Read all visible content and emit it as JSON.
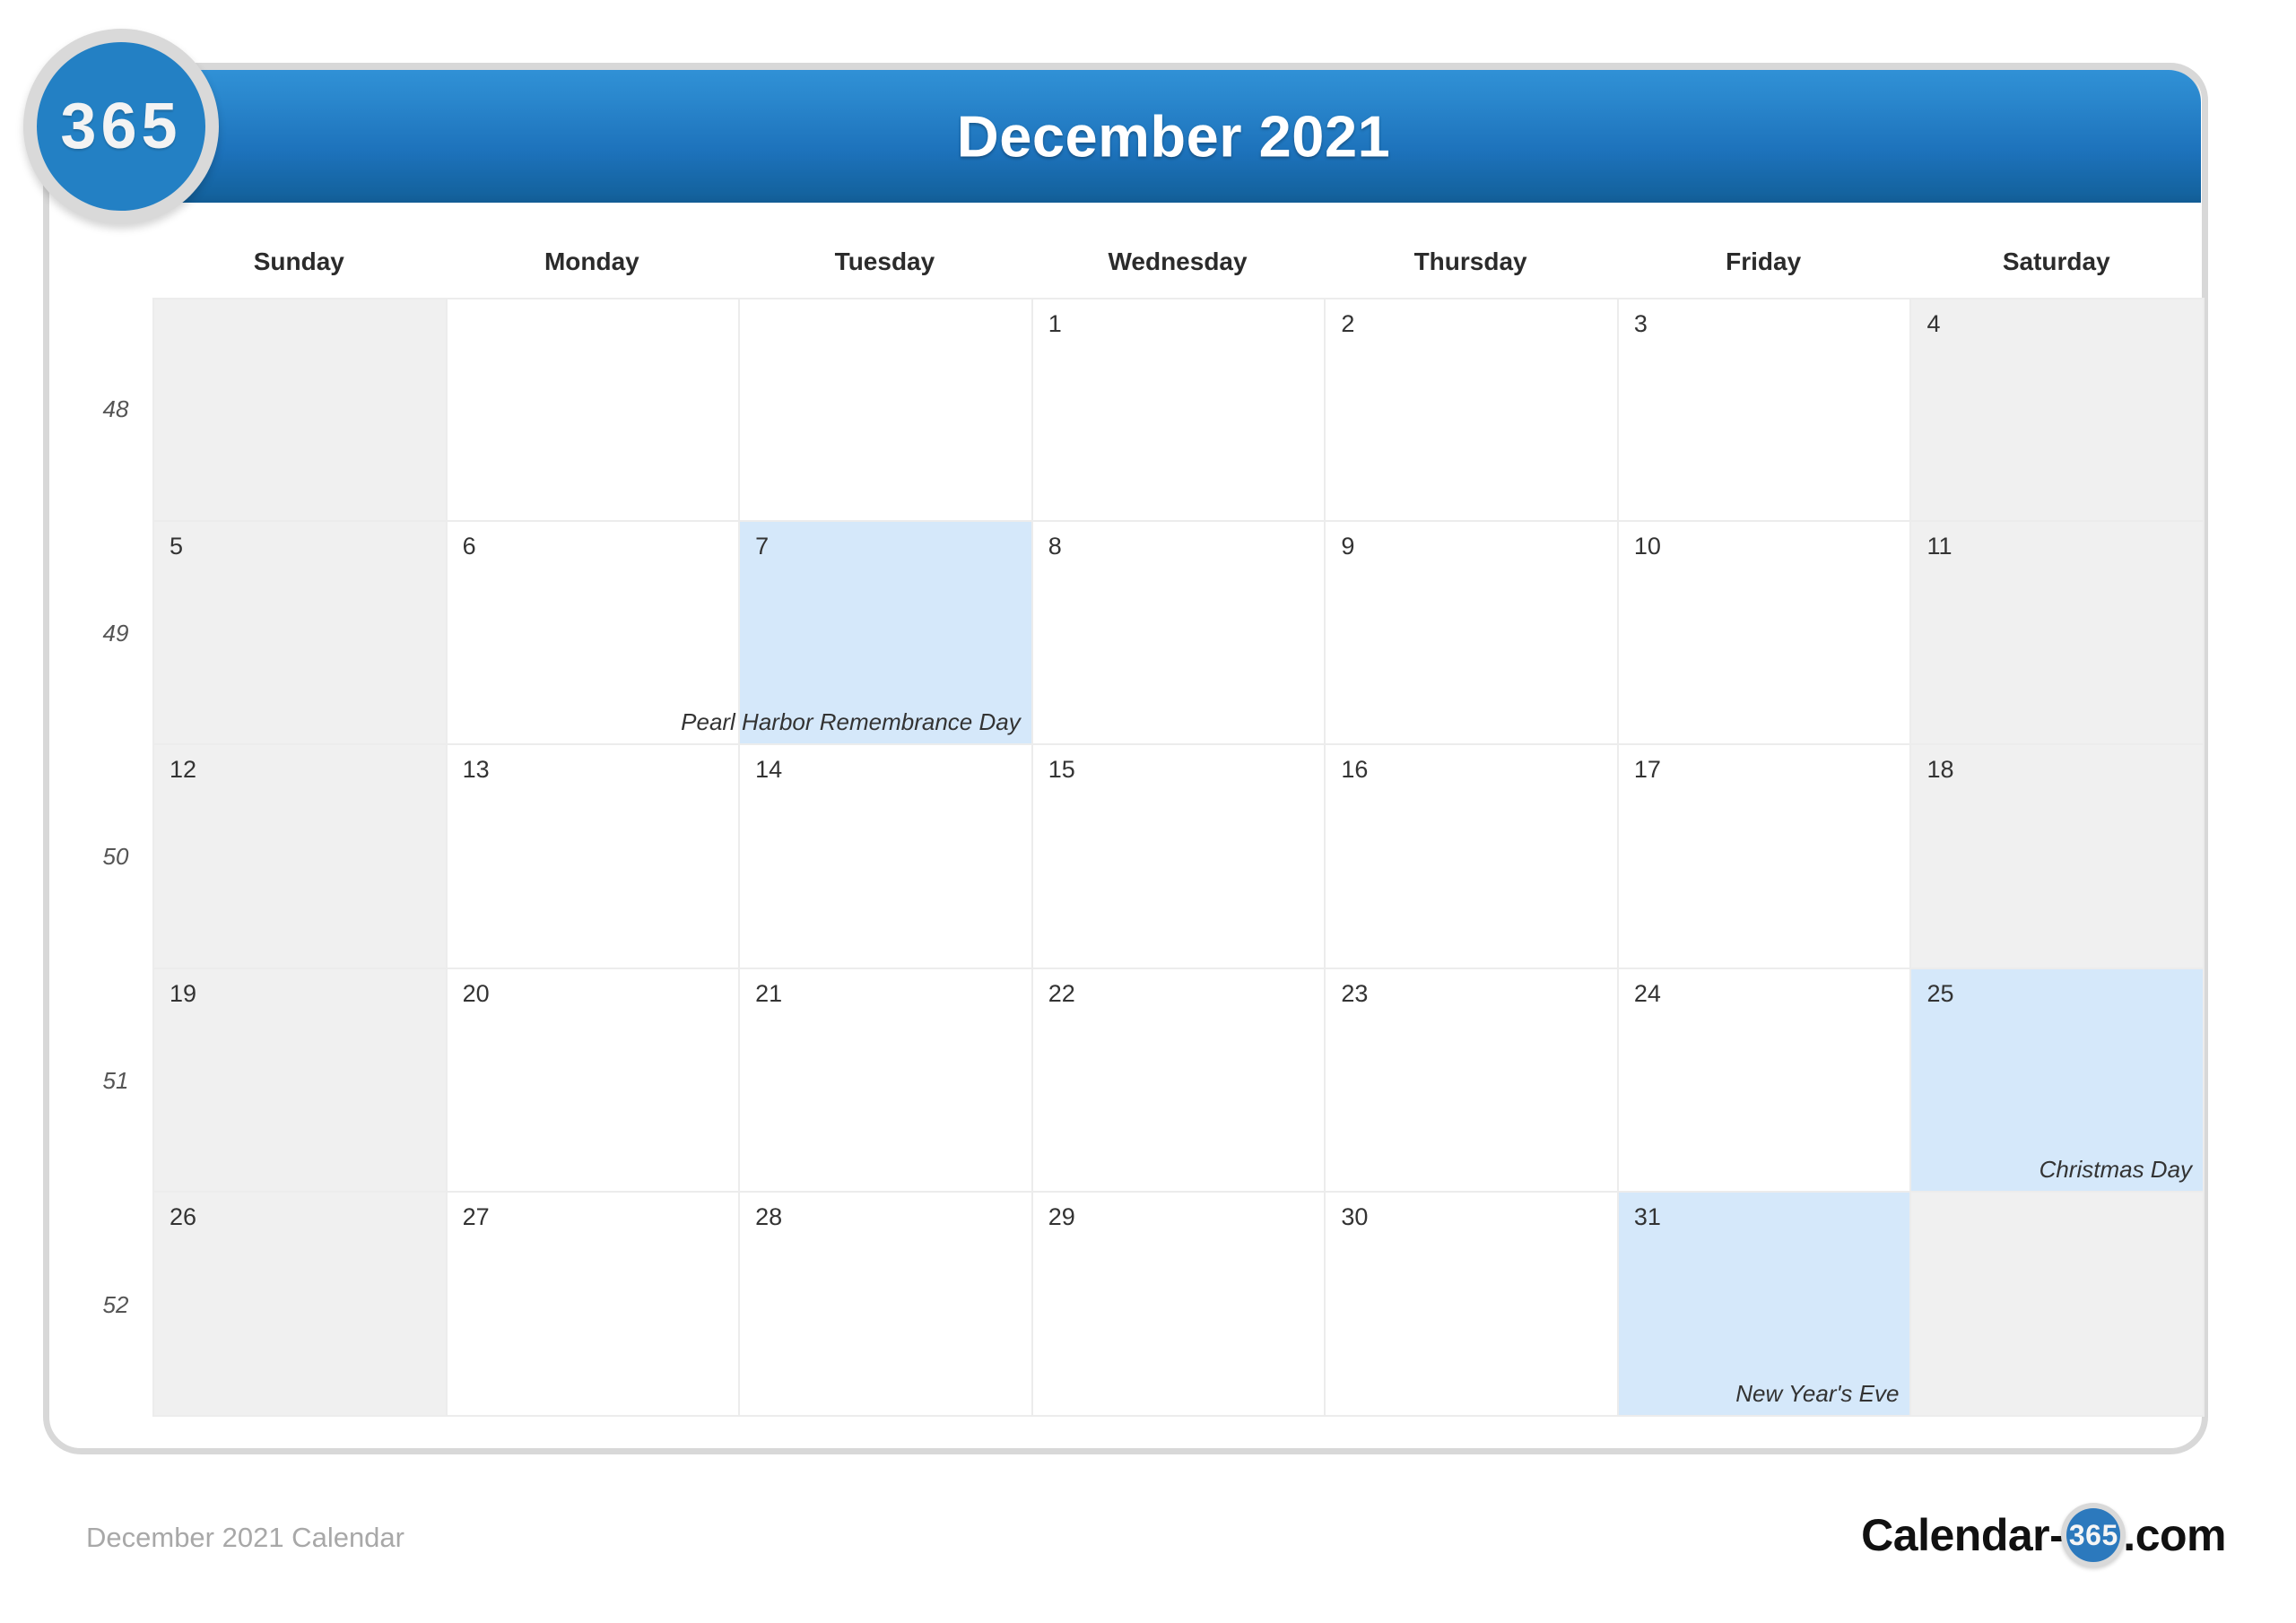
{
  "brand": {
    "badge_text": "365",
    "logo_prefix": "Calendar-",
    "logo_circle": "365",
    "logo_suffix": ".com"
  },
  "header": {
    "title": "December 2021"
  },
  "weekdays": [
    "Sunday",
    "Monday",
    "Tuesday",
    "Wednesday",
    "Thursday",
    "Friday",
    "Saturday"
  ],
  "week_numbers": [
    "48",
    "49",
    "50",
    "51",
    "52"
  ],
  "footer": {
    "caption": "December 2021 Calendar"
  },
  "colors": {
    "header_blue_top": "#3091d6",
    "header_blue_bottom": "#125c95",
    "weekend_shade": "#f0f0f0",
    "holiday_highlight": "#d5e8fa",
    "grid_line": "#ececec",
    "badge_blue": "#2380c4"
  },
  "watermark": "365",
  "calendar": {
    "month": "December",
    "year": "2021",
    "weeks": [
      {
        "week_number": "48",
        "days": [
          {
            "num": "",
            "weekend": true,
            "empty": true,
            "holiday": ""
          },
          {
            "num": "",
            "weekend": false,
            "empty": true,
            "holiday": ""
          },
          {
            "num": "",
            "weekend": false,
            "empty": true,
            "holiday": ""
          },
          {
            "num": "1",
            "weekend": false,
            "empty": false,
            "holiday": ""
          },
          {
            "num": "2",
            "weekend": false,
            "empty": false,
            "holiday": ""
          },
          {
            "num": "3",
            "weekend": false,
            "empty": false,
            "holiday": ""
          },
          {
            "num": "4",
            "weekend": true,
            "empty": false,
            "holiday": ""
          }
        ]
      },
      {
        "week_number": "49",
        "days": [
          {
            "num": "5",
            "weekend": true,
            "empty": false,
            "holiday": ""
          },
          {
            "num": "6",
            "weekend": false,
            "empty": false,
            "holiday": ""
          },
          {
            "num": "7",
            "weekend": false,
            "empty": false,
            "holiday": "Pearl Harbor Remembrance Day"
          },
          {
            "num": "8",
            "weekend": false,
            "empty": false,
            "holiday": ""
          },
          {
            "num": "9",
            "weekend": false,
            "empty": false,
            "holiday": ""
          },
          {
            "num": "10",
            "weekend": false,
            "empty": false,
            "holiday": ""
          },
          {
            "num": "11",
            "weekend": true,
            "empty": false,
            "holiday": ""
          }
        ]
      },
      {
        "week_number": "50",
        "days": [
          {
            "num": "12",
            "weekend": true,
            "empty": false,
            "holiday": ""
          },
          {
            "num": "13",
            "weekend": false,
            "empty": false,
            "holiday": ""
          },
          {
            "num": "14",
            "weekend": false,
            "empty": false,
            "holiday": ""
          },
          {
            "num": "15",
            "weekend": false,
            "empty": false,
            "holiday": ""
          },
          {
            "num": "16",
            "weekend": false,
            "empty": false,
            "holiday": ""
          },
          {
            "num": "17",
            "weekend": false,
            "empty": false,
            "holiday": ""
          },
          {
            "num": "18",
            "weekend": true,
            "empty": false,
            "holiday": ""
          }
        ]
      },
      {
        "week_number": "51",
        "days": [
          {
            "num": "19",
            "weekend": true,
            "empty": false,
            "holiday": ""
          },
          {
            "num": "20",
            "weekend": false,
            "empty": false,
            "holiday": ""
          },
          {
            "num": "21",
            "weekend": false,
            "empty": false,
            "holiday": ""
          },
          {
            "num": "22",
            "weekend": false,
            "empty": false,
            "holiday": ""
          },
          {
            "num": "23",
            "weekend": false,
            "empty": false,
            "holiday": ""
          },
          {
            "num": "24",
            "weekend": false,
            "empty": false,
            "holiday": ""
          },
          {
            "num": "25",
            "weekend": true,
            "empty": false,
            "holiday": "Christmas Day"
          }
        ]
      },
      {
        "week_number": "52",
        "days": [
          {
            "num": "26",
            "weekend": true,
            "empty": false,
            "holiday": ""
          },
          {
            "num": "27",
            "weekend": false,
            "empty": false,
            "holiday": ""
          },
          {
            "num": "28",
            "weekend": false,
            "empty": false,
            "holiday": ""
          },
          {
            "num": "29",
            "weekend": false,
            "empty": false,
            "holiday": ""
          },
          {
            "num": "30",
            "weekend": false,
            "empty": false,
            "holiday": ""
          },
          {
            "num": "31",
            "weekend": false,
            "empty": false,
            "holiday": "New Year's Eve"
          },
          {
            "num": "",
            "weekend": true,
            "empty": true,
            "holiday": ""
          }
        ]
      }
    ]
  }
}
